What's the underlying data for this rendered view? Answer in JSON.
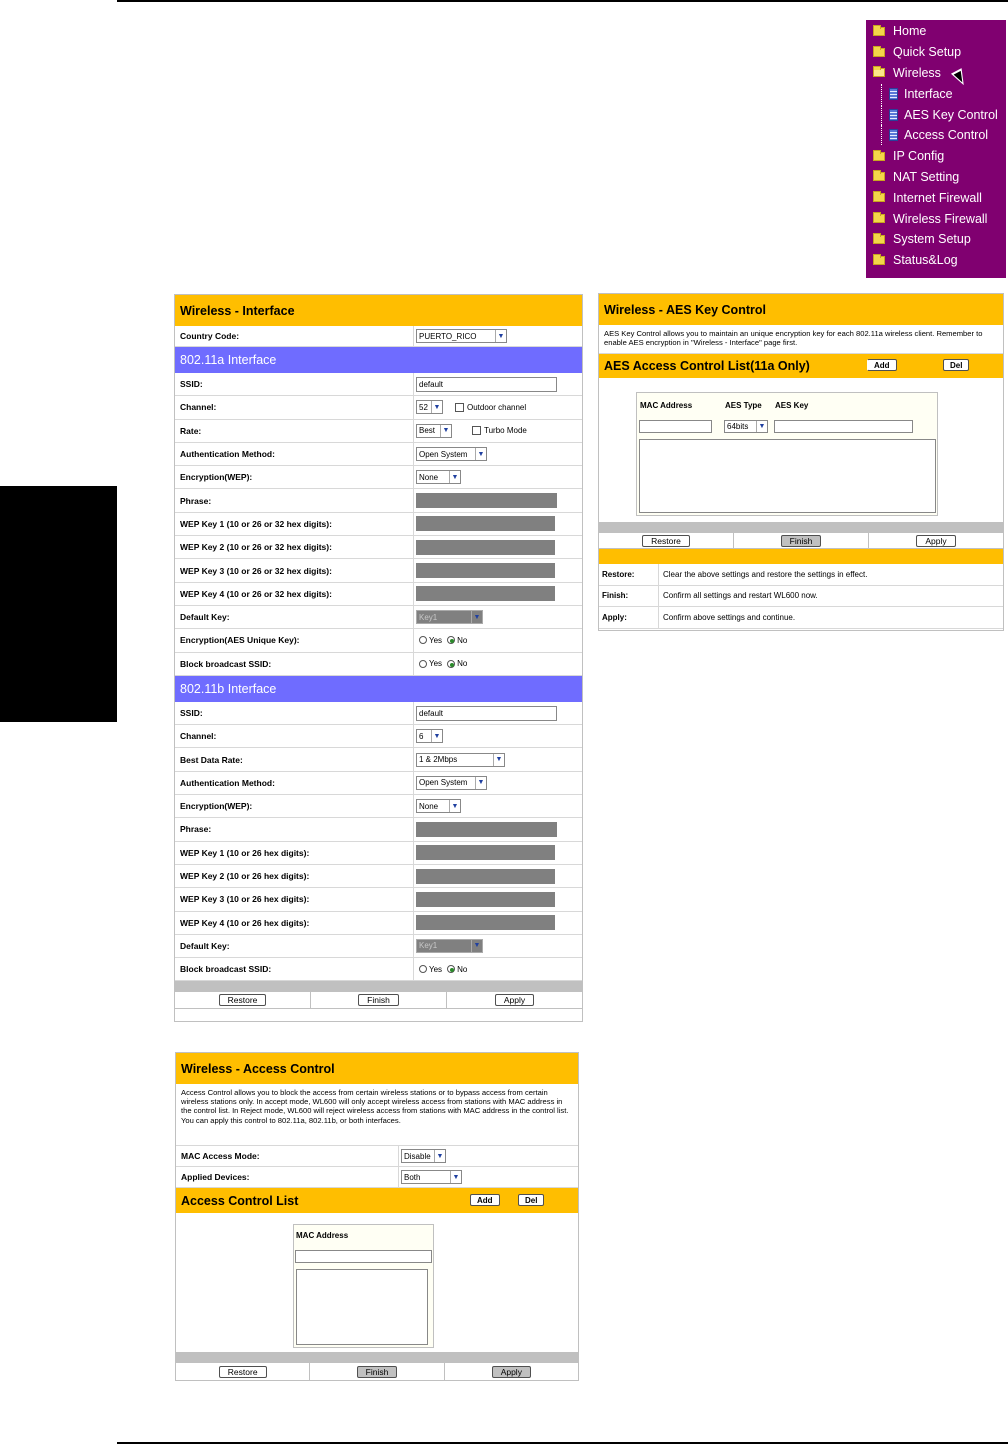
{
  "nav": {
    "items": [
      {
        "label": "Home",
        "kind": "top",
        "icon": "folder-icon"
      },
      {
        "label": "Quick Setup",
        "kind": "top",
        "icon": "folder-icon"
      },
      {
        "label": "Wireless",
        "kind": "top",
        "icon": "folder-open-icon"
      },
      {
        "label": "Interface",
        "kind": "sub",
        "icon": "document-icon"
      },
      {
        "label": "AES Key Control",
        "kind": "sub",
        "icon": "document-icon"
      },
      {
        "label": "Access Control",
        "kind": "sub",
        "icon": "document-icon"
      },
      {
        "label": "IP Config",
        "kind": "top",
        "icon": "folder-icon"
      },
      {
        "label": "NAT Setting",
        "kind": "top",
        "icon": "folder-icon"
      },
      {
        "label": "Internet Firewall",
        "kind": "top",
        "icon": "folder-icon"
      },
      {
        "label": "Wireless Firewall",
        "kind": "top",
        "icon": "folder-icon"
      },
      {
        "label": "System Setup",
        "kind": "top",
        "icon": "folder-icon"
      },
      {
        "label": "Status&Log",
        "kind": "top",
        "icon": "folder-icon"
      }
    ]
  },
  "iface": {
    "title": "Wireless - Interface",
    "country_label": "Country Code:",
    "country_value": "PUERTO_RICO",
    "a_head": "802.11a Interface",
    "a_ssid_label": "SSID:",
    "a_ssid_value": "default",
    "a_channel_label": "Channel:",
    "a_channel_value": "52",
    "a_outdoor_label": "Outdoor channel",
    "a_rate_label": "Rate:",
    "a_rate_value": "Best",
    "a_turbo_label": "Turbo Mode",
    "a_auth_label": "Authentication Method:",
    "a_auth_value": "Open System",
    "a_enc_label": "Encryption(WEP):",
    "a_enc_value": "None",
    "a_phrase_label": "Phrase:",
    "a_wep1_label": "WEP Key 1 (10 or 26 or 32 hex digits):",
    "a_wep2_label": "WEP Key 2 (10 or 26 or 32 hex digits):",
    "a_wep3_label": "WEP Key 3 (10 or 26 or 32 hex digits):",
    "a_wep4_label": "WEP Key 4 (10 or 26 or 32 hex digits):",
    "a_defkey_label": "Default Key:",
    "a_defkey_value": "Key1",
    "a_aes_label": "Encryption(AES Unique Key):",
    "a_block_label": "Block broadcast SSID:",
    "yes": "Yes",
    "no": "No",
    "b_head": "802.11b Interface",
    "b_ssid_label": "SSID:",
    "b_ssid_value": "default",
    "b_channel_label": "Channel:",
    "b_channel_value": "6",
    "b_rate_label": "Best Data Rate:",
    "b_rate_value": "1 & 2Mbps",
    "b_auth_label": "Authentication Method:",
    "b_auth_value": "Open System",
    "b_enc_label": "Encryption(WEP):",
    "b_enc_value": "None",
    "b_phrase_label": "Phrase:",
    "b_wep1_label": "WEP Key 1 (10 or 26 hex digits):",
    "b_wep2_label": "WEP Key 2 (10 or 26 hex digits):",
    "b_wep3_label": "WEP Key 3 (10 or 26 hex digits):",
    "b_wep4_label": "WEP Key 4 (10 or 26 hex digits):",
    "b_defkey_label": "Default Key:",
    "b_defkey_value": "Key1",
    "b_block_label": "Block broadcast SSID:",
    "restore": "Restore",
    "finish": "Finish",
    "apply": "Apply"
  },
  "aes": {
    "title": "Wireless - AES Key Control",
    "desc": "AES Key Control allows you to maintain an unique encryption key for each 802.11a wireless client. Remember to enable AES encryption in \"Wireless - Interface\" page first.",
    "list_title": "AES Access Control List(11a Only)",
    "add": "Add",
    "del": "Del",
    "col_mac": "MAC Address",
    "col_type": "AES Type",
    "col_key": "AES Key",
    "type_value": "64bits",
    "restore": "Restore",
    "finish": "Finish",
    "apply": "Apply",
    "help": [
      {
        "term": "Restore:",
        "text": "Clear the above settings and restore the settings in effect."
      },
      {
        "term": "Finish:",
        "text": "Confirm all settings and restart WL600 now."
      },
      {
        "term": "Apply:",
        "text": "Confirm above settings and continue."
      }
    ]
  },
  "access": {
    "title": "Wireless - Access Control",
    "desc": "Access Control allows you to block the access from certain wireless stations or to bypass access from certain wireless stations only. In accept mode, WL600 will only accept wireless access from stations with MAC address in the control list. In Reject mode, WL600 will reject wireless access from stations with MAC address in the control list. You can apply this control to 802.11a, 802.11b, or both interfaces.",
    "mode_label": "MAC Access Mode:",
    "mode_value": "Disable",
    "devices_label": "Applied Devices:",
    "devices_value": "Both",
    "list_title": "Access Control List",
    "add": "Add",
    "del": "Del",
    "col_mac": "MAC Address",
    "restore": "Restore",
    "finish": "Finish",
    "apply": "Apply"
  }
}
